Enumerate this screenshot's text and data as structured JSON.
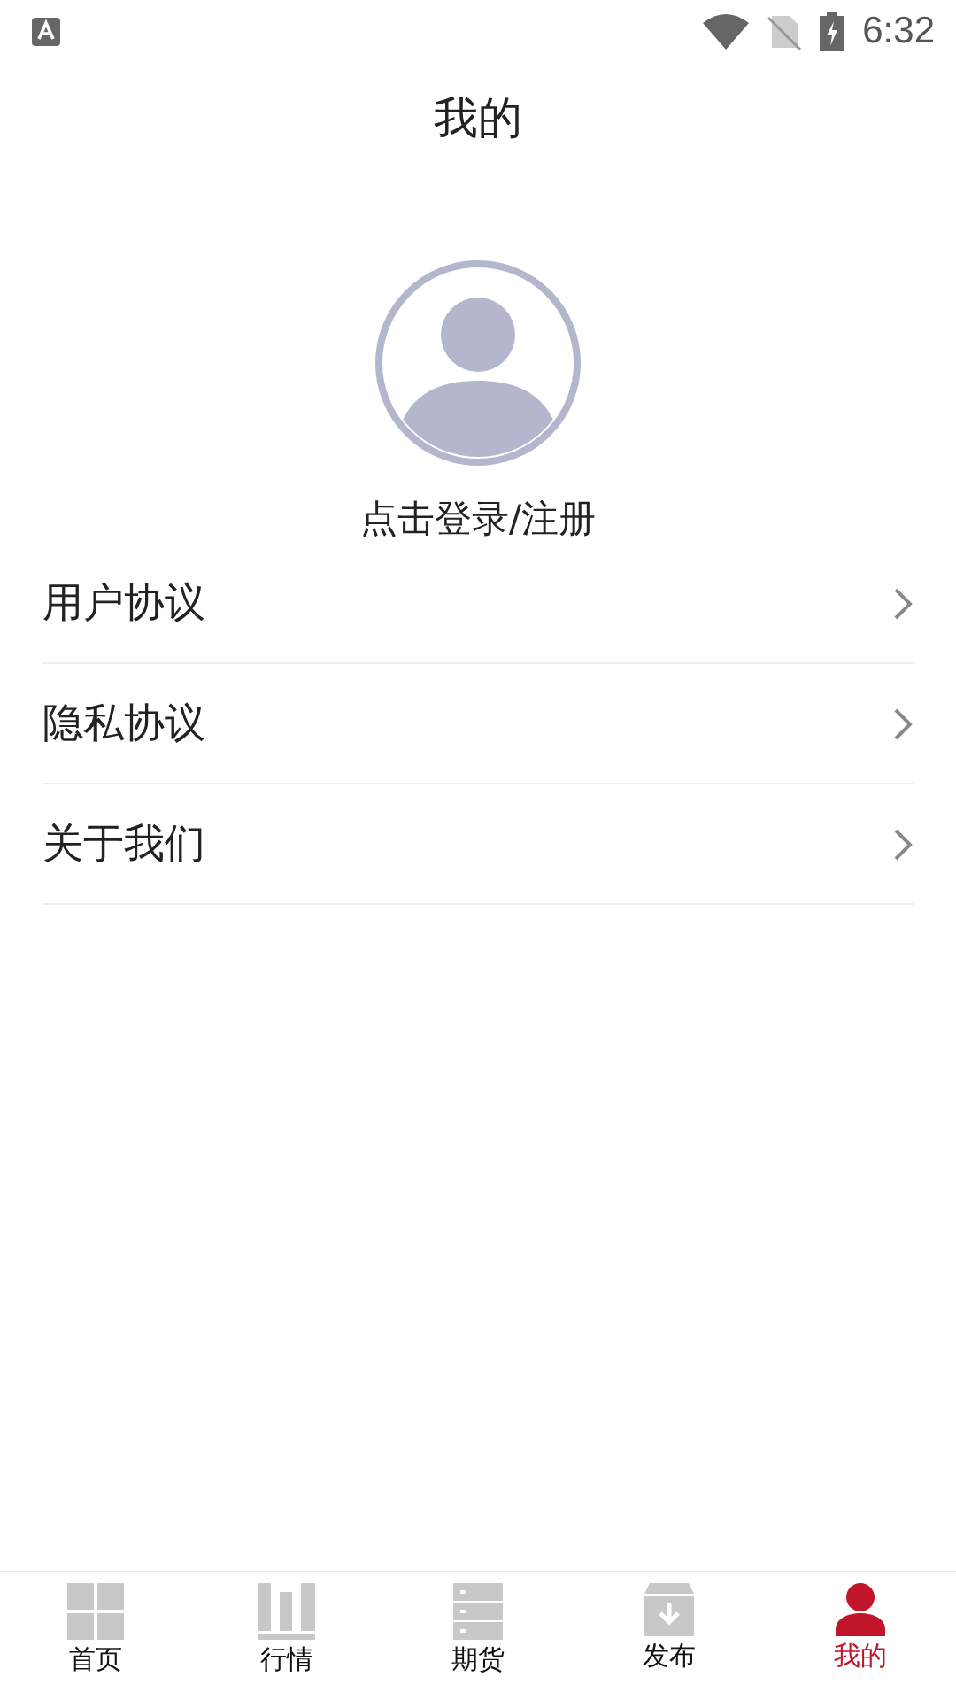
{
  "status_bar": {
    "time": "6:32"
  },
  "header": {
    "title": "我的"
  },
  "profile": {
    "login_label": "点击登录/注册"
  },
  "menu": [
    {
      "label": "用户协议"
    },
    {
      "label": "隐私协议"
    },
    {
      "label": "关于我们"
    }
  ],
  "tabs": [
    {
      "label": "首页",
      "kind": "grid",
      "selected": false
    },
    {
      "label": "行情",
      "kind": "bars",
      "selected": false
    },
    {
      "label": "期货",
      "kind": "server",
      "selected": false
    },
    {
      "label": "发布",
      "kind": "box",
      "selected": false
    },
    {
      "label": "我的",
      "kind": "person",
      "selected": true
    }
  ]
}
